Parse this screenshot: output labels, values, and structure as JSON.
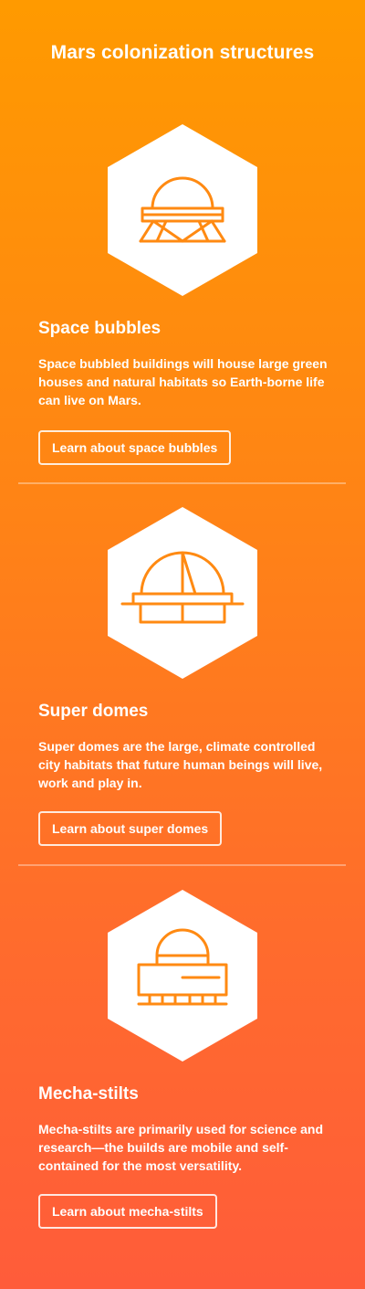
{
  "page": {
    "title": "Mars colonization structures"
  },
  "colors": {
    "gradient_top": "#ff9a00",
    "gradient_bottom": "#ff5c3a",
    "icon_stroke": "#ff8a12",
    "hex_fill": "#ffffff"
  },
  "sections": [
    {
      "icon": "space-bubble-icon",
      "title": "Space bubbles",
      "description": "Space bubbled buildings will house large green houses and natural habitats so Earth-borne life can live on Mars.",
      "button_label": "Learn about space bubbles"
    },
    {
      "icon": "super-dome-icon",
      "title": "Super domes",
      "description": "Super domes are the large, climate controlled city habitats that future human beings will live, work and play in.",
      "button_label": "Learn about super domes"
    },
    {
      "icon": "mecha-stilts-icon",
      "title": "Mecha-stilts",
      "description": "Mecha-stilts are primarily used for science and research—the builds are mobile and self-contained for the most versatility.",
      "button_label": "Learn about mecha-stilts"
    }
  ]
}
